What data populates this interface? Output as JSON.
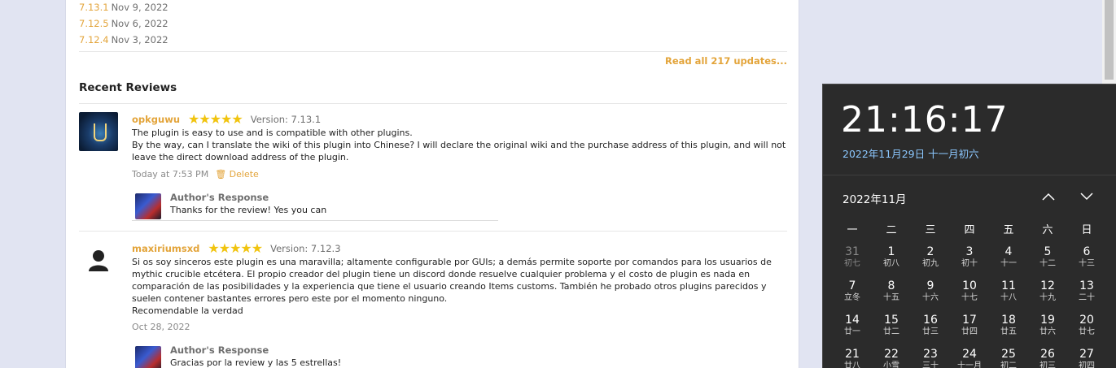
{
  "updates": [
    {
      "version": "7.13.1",
      "date": "Nov 9, 2022"
    },
    {
      "version": "7.12.5",
      "date": "Nov 6, 2022"
    },
    {
      "version": "7.12.4",
      "date": "Nov 3, 2022"
    }
  ],
  "read_all_label": "Read all 217 updates...",
  "recent_reviews_title": "Recent Reviews",
  "reviews": [
    {
      "username": "opkguwu",
      "stars": "★★★★★",
      "version": "Version: 7.13.1",
      "lines": [
        "The plugin is easy to use and is compatible with other plugins.",
        "By the way, can I translate the wiki of this plugin into Chinese? I will declare the original wiki and the purchase address of this plugin, and will not leave the direct download address of the plugin."
      ],
      "time": "Today at 7:53 PM",
      "delete_label": "🗑 Delete",
      "response_title": "Author's Response",
      "response_text": "Thanks for the review! Yes you can"
    },
    {
      "username": "maxiriumsxd",
      "stars": "★★★★★",
      "version": "Version: 7.12.3",
      "lines": [
        "Si os soy sinceros este plugin es una maravilla; altamente configurable por GUIs; a demás permite soporte por comandos para los usuarios de mythic crucible etcétera. El propio creador del plugin tiene un discord donde resuelve cualquier problema y el costo de plugin es nada en comparación de las posibilidades y la experiencia que tiene el usuario creando Items customs. También he probado otros plugins parecidos y suelen contener bastantes errores pero este por el momento ninguno.",
        "Recomendable la verdad"
      ],
      "time": "Oct 28, 2022",
      "response_title": "Author's Response",
      "response_text": "Gracias por la review y las 5 estrellas!"
    }
  ],
  "clock": {
    "time": "21:16:17",
    "date": "2022年11月29日 十一月初六",
    "month": "2022年11月",
    "weekdays": [
      "一",
      "二",
      "三",
      "四",
      "五",
      "六",
      "日"
    ],
    "days": [
      {
        "n": "31",
        "l": "初七",
        "muted": true
      },
      {
        "n": "1",
        "l": "初八"
      },
      {
        "n": "2",
        "l": "初九"
      },
      {
        "n": "3",
        "l": "初十"
      },
      {
        "n": "4",
        "l": "十一"
      },
      {
        "n": "5",
        "l": "十二"
      },
      {
        "n": "6",
        "l": "十三"
      },
      {
        "n": "7",
        "l": "立冬"
      },
      {
        "n": "8",
        "l": "十五"
      },
      {
        "n": "9",
        "l": "十六"
      },
      {
        "n": "10",
        "l": "十七"
      },
      {
        "n": "11",
        "l": "十八"
      },
      {
        "n": "12",
        "l": "十九"
      },
      {
        "n": "13",
        "l": "二十"
      },
      {
        "n": "14",
        "l": "廿一"
      },
      {
        "n": "15",
        "l": "廿二"
      },
      {
        "n": "16",
        "l": "廿三"
      },
      {
        "n": "17",
        "l": "廿四"
      },
      {
        "n": "18",
        "l": "廿五"
      },
      {
        "n": "19",
        "l": "廿六"
      },
      {
        "n": "20",
        "l": "廿七"
      },
      {
        "n": "21",
        "l": "廿八"
      },
      {
        "n": "22",
        "l": "小雪"
      },
      {
        "n": "23",
        "l": "三十"
      },
      {
        "n": "24",
        "l": "十一月"
      },
      {
        "n": "25",
        "l": "初二"
      },
      {
        "n": "26",
        "l": "初三"
      },
      {
        "n": "27",
        "l": "初四"
      }
    ]
  },
  "colors": {
    "accent": "#e3a43a",
    "star": "#f1c40f",
    "link_blue": "#8cc8ff"
  }
}
